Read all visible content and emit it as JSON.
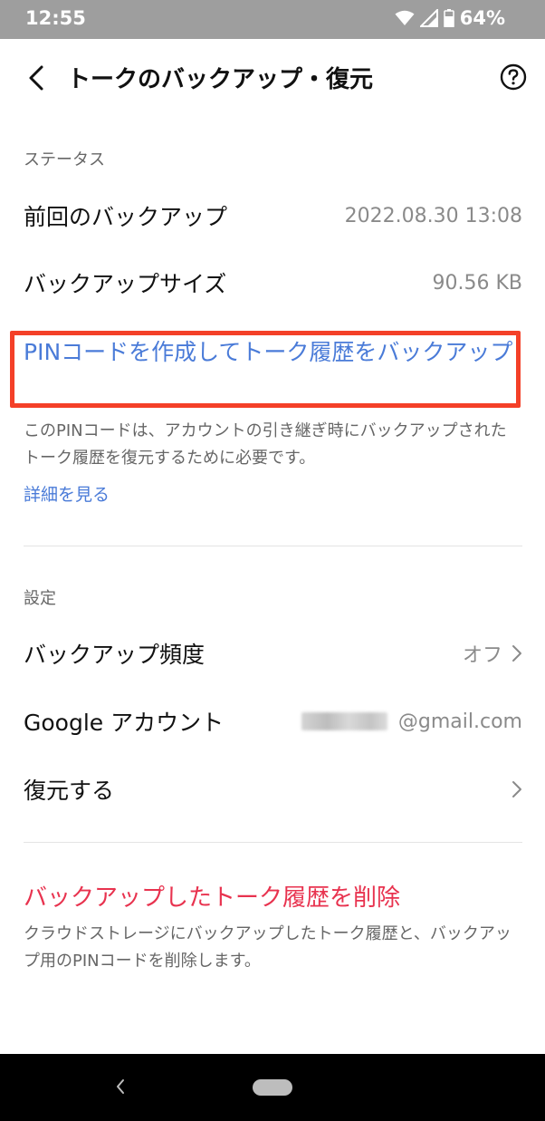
{
  "status_bar": {
    "time": "12:55",
    "battery": "64%",
    "icons": [
      "wifi-icon",
      "signal-icon",
      "battery-icon"
    ]
  },
  "header": {
    "title": "トークのバックアップ・復元",
    "back_icon": "chevron-left-icon",
    "help_icon": "help-icon"
  },
  "status_section": {
    "header": "ステータス",
    "rows": [
      {
        "label": "前回のバックアップ",
        "value": "2022.08.30 13:08"
      },
      {
        "label": "バックアップサイズ",
        "value": "90.56 KB"
      }
    ]
  },
  "pin": {
    "link": "PINコードを作成してトーク履歴をバックアップ",
    "description": "このPINコードは、アカウントの引き継ぎ時にバックアップされたトーク履歴を復元するために必要です。",
    "detail_link": "詳細を見る"
  },
  "settings_section": {
    "header": "設定",
    "frequency": {
      "label": "バックアップ頻度",
      "value": "オフ"
    },
    "google": {
      "label": "Google アカウント",
      "value": "@gmail.com"
    },
    "restore": {
      "label": "復元する"
    }
  },
  "delete": {
    "link": "バックアップしたトーク履歴を削除",
    "description": "クラウドストレージにバックアップしたトーク履歴と、バックアップ用のPINコードを削除します。"
  },
  "colors": {
    "status_bar": "#9e9e9e",
    "link_blue": "#4a7bd8",
    "highlight_red": "#f44028",
    "delete_red": "#e8334f",
    "nav_bar": "#000000"
  }
}
